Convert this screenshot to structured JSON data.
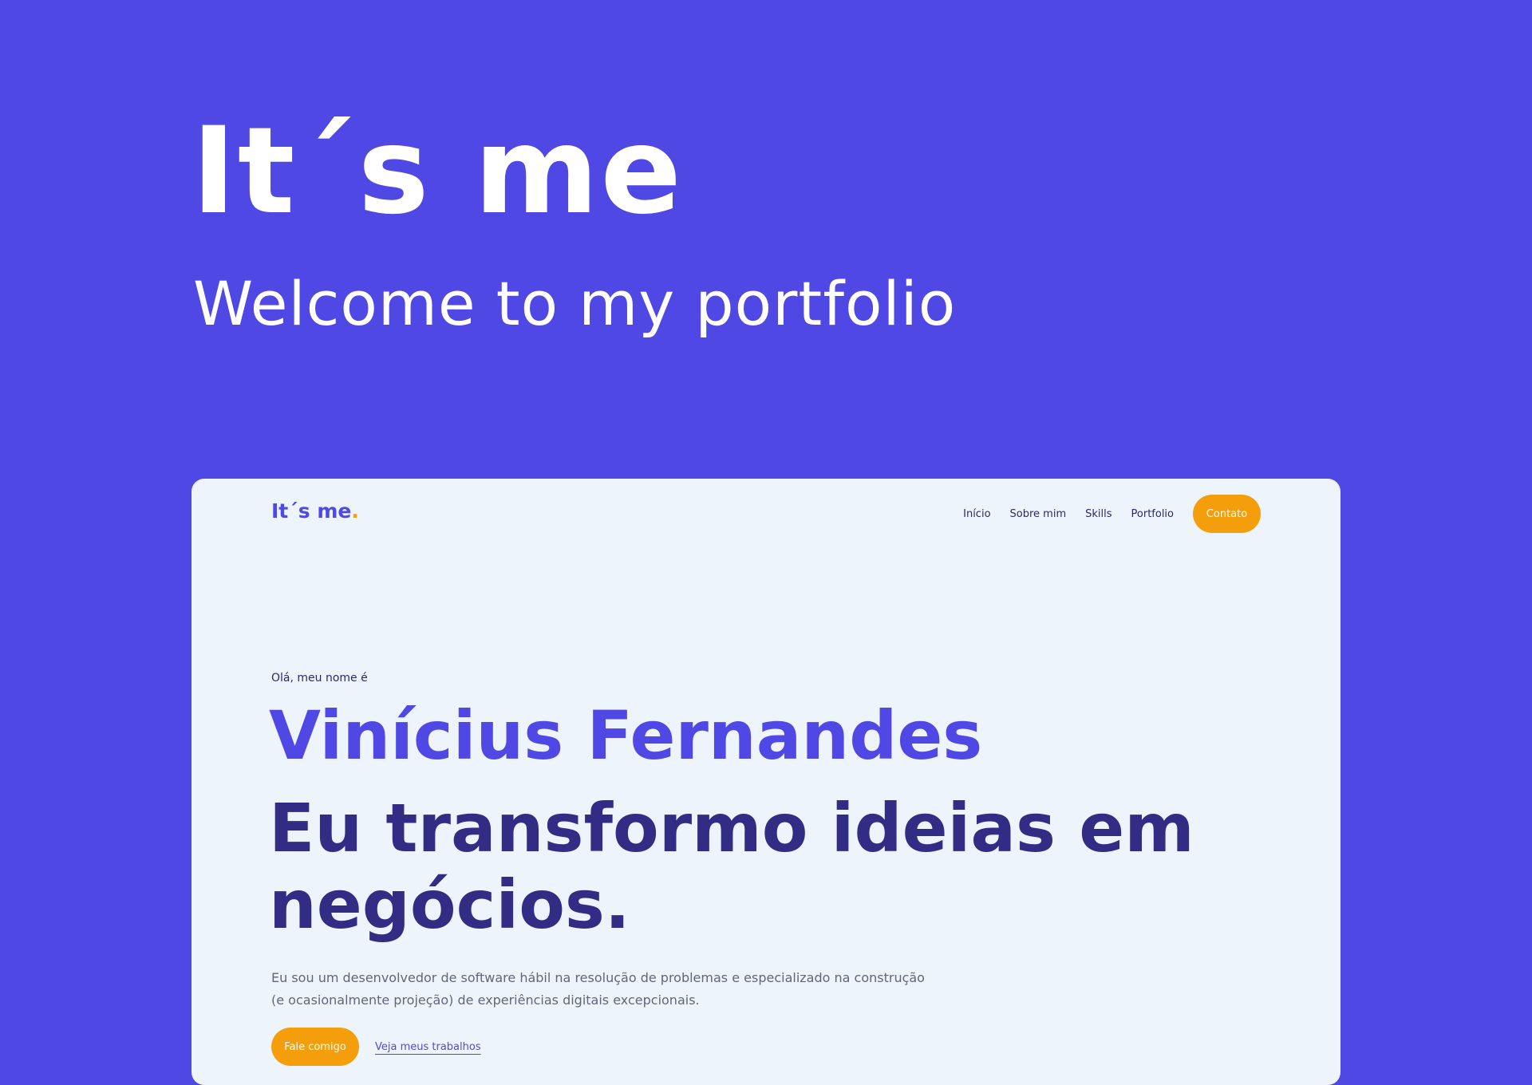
{
  "hero": {
    "title": "It´s me",
    "subtitle": "Welcome to my portfolio"
  },
  "site": {
    "logo_text": "It´s me",
    "logo_dot": ".",
    "nav": {
      "items": [
        {
          "label": "Início"
        },
        {
          "label": "Sobre mim"
        },
        {
          "label": "Skills"
        },
        {
          "label": "Portfolio"
        }
      ],
      "cta_label": "Contato"
    },
    "intro": {
      "greeting": "Olá, meu nome é",
      "name": "Vinícius Fernandes",
      "headline": "Eu transformo ideias em negócios.",
      "description": "Eu sou um desenvolvedor de software hábil na resolução de problemas e especializado na construção (e ocasionalmente projeção) de experiências digitais excepcionais.",
      "primary_button": "Fale comigo",
      "secondary_link": "Veja meus trabalhos"
    }
  },
  "colors": {
    "background": "#5048E5",
    "card_background": "#EEF4FC",
    "accent": "#F59E0B",
    "name": "#5048E5",
    "headline": "#312C84"
  }
}
